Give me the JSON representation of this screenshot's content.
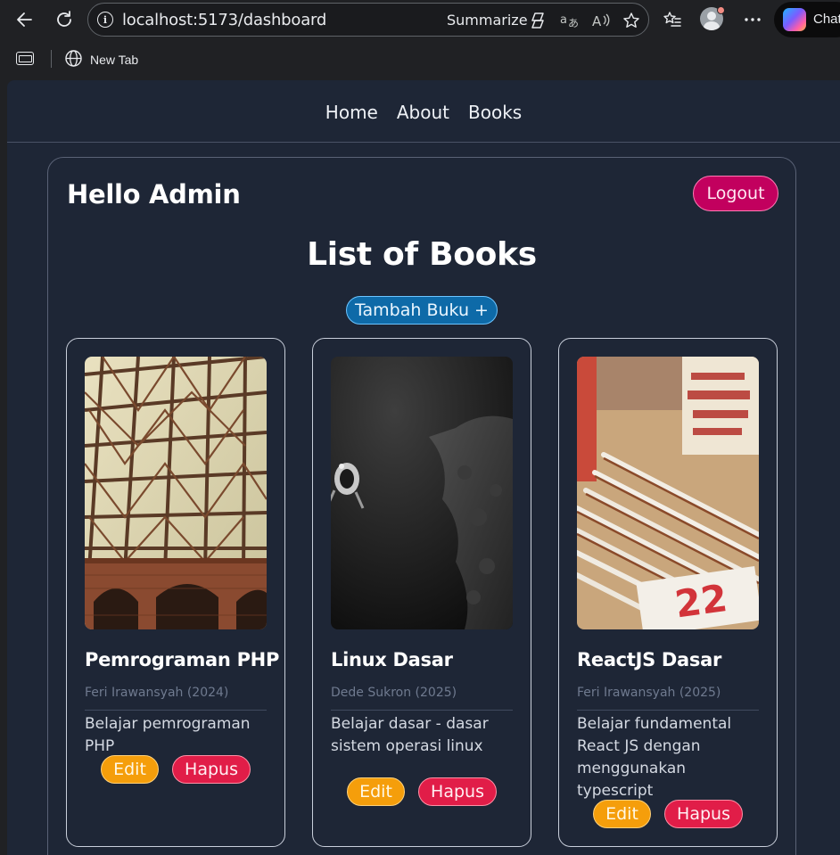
{
  "browser": {
    "url": "localhost:5173/dashboard",
    "summarize_label": "Summarize",
    "copilot_label": "Chat",
    "favorites": [
      {
        "label": "New Tab"
      }
    ]
  },
  "site_nav": {
    "links": [
      {
        "label": "Home"
      },
      {
        "label": "About"
      },
      {
        "label": "Books"
      }
    ]
  },
  "dashboard": {
    "greeting": "Hello Admin",
    "logout_label": "Logout",
    "list_title": "List of Books",
    "add_button_label": "Tambah Buku +",
    "edit_label": "Edit",
    "delete_label": "Hapus"
  },
  "books": [
    {
      "title": "Pemrograman PHP",
      "meta": "Feri Irawansyah (2024)",
      "description": "Belajar pemrograman PHP"
    },
    {
      "title": "Linux Dasar",
      "meta": "Dede Sukron (2025)",
      "description": "Belajar dasar - dasar sistem operasi linux"
    },
    {
      "title": "ReactJS Dasar",
      "meta": "Feri Irawansyah (2025)",
      "description": "Belajar fundamental React JS dengan menggunakan typescript"
    }
  ],
  "colors": {
    "page_bg": "#1e2636",
    "logout": "#c2005e",
    "add": "#0e6aa8",
    "edit": "#f59e0b",
    "delete": "#e11d48"
  }
}
